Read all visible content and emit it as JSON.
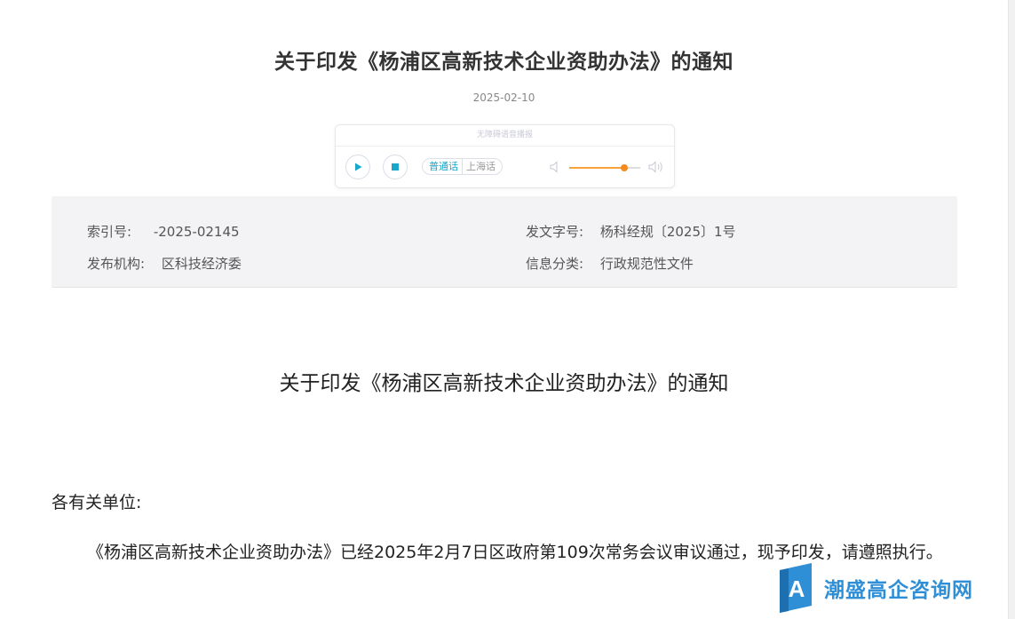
{
  "article": {
    "title": "关于印发《杨浦区高新技术企业资助办法》的通知",
    "date": "2025-02-10"
  },
  "player": {
    "header": "无障碍语音播报",
    "dialects": [
      "普通话",
      "上海话"
    ],
    "active_dialect": "普通话",
    "volume_level": 0.78,
    "icons": [
      "play-icon",
      "stop-icon",
      "volume-low-icon",
      "volume-high-icon"
    ],
    "colors": {
      "accent": "#1aa7c9",
      "slider": "#f58a1f"
    }
  },
  "meta": {
    "index_label": "索引号:",
    "index_value": "-2025-02145",
    "doc_no_label": "发文字号:",
    "doc_no_value": "杨科经规〔2025〕1号",
    "org_label": "发布机构:",
    "org_value": "区科技经济委",
    "category_label": "信息分类:",
    "category_value": "行政规范性文件"
  },
  "body": {
    "doc_title": "关于印发《杨浦区高新技术企业资助办法》的通知",
    "salutation": "各有关单位:",
    "paragraph": "《杨浦区高新技术企业资助办法》已经2025年2月7日区政府第109次常务会议审议通过，现予印发，请遵照执行。"
  },
  "watermark": {
    "logo_letter": "A",
    "text": "潮盛高企咨询网",
    "color": "#2f8fd6"
  }
}
